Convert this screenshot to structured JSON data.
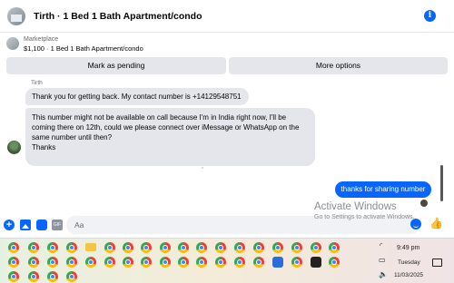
{
  "header": {
    "title": "Tirth · 1 Bed 1 Bath Apartment/condo",
    "info_icon": "info-icon",
    "info_glyph": "i"
  },
  "marketplace": {
    "source": "Marketplace",
    "listing": "$1,100 · 1 Bed 1 Bath Apartment/condo"
  },
  "actions": {
    "mark_pending": "Mark as pending",
    "more_options": "More options"
  },
  "conversation": {
    "sender_name": "Tirth",
    "incoming": [
      "Thank you for getting back. My contact number is +14129548751",
      "This number might not be available on call because I'm in India right now, I'll be coming there on 12th, could we please connect over iMessage or WhatsApp on the same number until then?\nThanks"
    ],
    "outgoing": [
      "thanks for sharing number"
    ]
  },
  "composer": {
    "placeholder": "Aa",
    "icons": [
      "plus-icon",
      "photo-icon",
      "sticker-icon",
      "gif-icon",
      "emoji-icon",
      "like-icon"
    ],
    "plus_glyph": "+",
    "gif_glyph": "GIF",
    "like_glyph": "👍"
  },
  "watermark": {
    "title": "Activate Windows",
    "subtitle": "Go to Settings to activate Windows."
  },
  "taskbar": {
    "time": "9:49 pm",
    "day": "Tuesday",
    "date": "11/03/2025",
    "wifi_glyph": "◜",
    "battery_glyph": "▭",
    "speaker_glyph": "🔈"
  },
  "colors": {
    "accent": "#0866ff",
    "bubble_incoming": "#e4e6eb",
    "bubble_outgoing": "#0866ff"
  }
}
